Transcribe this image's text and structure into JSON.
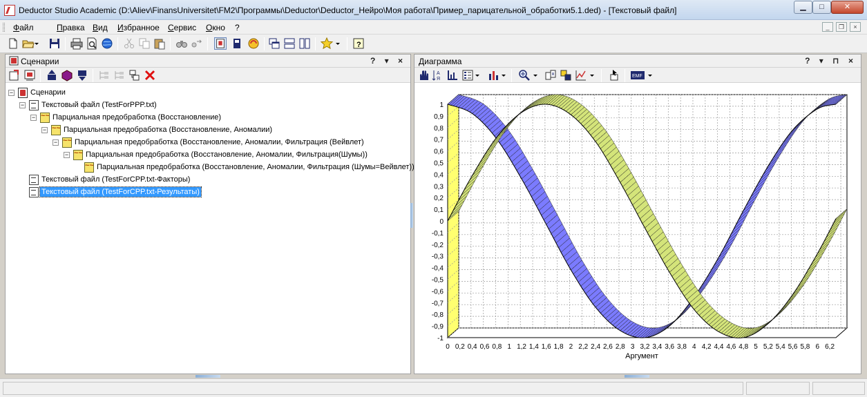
{
  "window": {
    "title": "Deductor Studio Academic (D:\\Aliev\\FinansUniversitet\\FM2\\Программы\\Deductor\\Deductor_Нейро\\Моя работа\\Пример_парицательной_обработки5.1.ded) - [Текстовый файл]"
  },
  "menu": [
    "Файл",
    "Правка",
    "Вид",
    "Избранное",
    "Сервис",
    "Окно",
    "?"
  ],
  "left_panel": {
    "title": "Сценарии",
    "controls": "? ▾ ×"
  },
  "tree": [
    {
      "label": "Сценарии",
      "level": 0,
      "icon": "scenario-icon",
      "expander": "−"
    },
    {
      "label": "Текстовый файл (TestForPPP.txt)",
      "level": 1,
      "icon": "text-file-icon",
      "expander": "−"
    },
    {
      "label": "Парциальная предобработка (Восстановление)",
      "level": 2,
      "icon": "preprocess-icon",
      "expander": "−"
    },
    {
      "label": "Парциальная предобработка (Восстановление, Аномалии)",
      "level": 3,
      "icon": "preprocess-icon",
      "expander": "−"
    },
    {
      "label": "Парциальная предобработка (Восстановление, Аномалии, Фильтрация (Вейвлет)",
      "level": 4,
      "icon": "preprocess-icon",
      "expander": "−"
    },
    {
      "label": "Парциальная предобработка (Восстановление, Аномалии, Фильтрация(Шумы))",
      "level": 5,
      "icon": "preprocess-icon",
      "expander": "−"
    },
    {
      "label": "Парциальная предобработка (Восстановление, Аномалии, Фильтрация (Шумы=Вейвлет))",
      "level": 6,
      "icon": "preprocess-icon",
      "expander": ""
    },
    {
      "label": "Текстовый файл (TestForCPP.txt-Факторы)",
      "level": 1,
      "icon": "text-file-icon",
      "expander": ""
    },
    {
      "label": "Текстовый файл (TestForCPP.txt-Результаты)",
      "level": 1,
      "icon": "text-file-icon",
      "expander": "",
      "selected": true
    }
  ],
  "right_panel": {
    "title": "Диаграмма",
    "controls": "? ▾ ⊓ ×"
  },
  "chart_data": {
    "type": "line",
    "style": "3d-ribbon",
    "xlabel": "Аргумент",
    "ylabel": "",
    "xlim": [
      0,
      6.3
    ],
    "ylim": [
      -1,
      1
    ],
    "x_ticks": [
      "0",
      "0,2",
      "0,4",
      "0,6",
      "0,8",
      "1",
      "1,2",
      "1,4",
      "1,6",
      "1,8",
      "2",
      "2,2",
      "2,4",
      "2,6",
      "2,8",
      "3",
      "3,2",
      "3,4",
      "3,6",
      "3,8",
      "4",
      "4,2",
      "4,4",
      "4,6",
      "4,8",
      "5",
      "5,2",
      "5,4",
      "5,6",
      "5,8",
      "6",
      "6,2"
    ],
    "y_ticks": [
      "-1",
      "-0,9",
      "-0,8",
      "-0,7",
      "-0,6",
      "-0,5",
      "-0,4",
      "-0,3",
      "-0,2",
      "-0,1",
      "0",
      "0,1",
      "0,2",
      "0,3",
      "0,4",
      "0,5",
      "0,6",
      "0,7",
      "0,8",
      "0,9",
      "1"
    ],
    "grid": true,
    "series": [
      {
        "color": "#7b7bff",
        "x": [
          0,
          0.4,
          0.8,
          1.2,
          1.6,
          2.0,
          2.4,
          2.8,
          3.2,
          3.6,
          4.0,
          4.4,
          4.8,
          5.2,
          5.6,
          6.0,
          6.3
        ],
        "values": [
          1.0,
          0.92,
          0.7,
          0.36,
          -0.03,
          -0.42,
          -0.74,
          -0.94,
          -1.0,
          -0.9,
          -0.65,
          -0.31,
          0.09,
          0.47,
          0.78,
          0.96,
          1.0
        ]
      },
      {
        "color": "#d4e47a",
        "x": [
          0,
          0.4,
          0.8,
          1.2,
          1.6,
          2.0,
          2.4,
          2.8,
          3.2,
          3.6,
          4.0,
          4.4,
          4.8,
          5.2,
          5.6,
          6.0,
          6.3
        ],
        "values": [
          0.0,
          0.39,
          0.72,
          0.93,
          1.0,
          0.91,
          0.68,
          0.33,
          -0.06,
          -0.44,
          -0.76,
          -0.95,
          -1.0,
          -0.88,
          -0.63,
          -0.28,
          0.02
        ]
      }
    ],
    "wall_color": "#ffff70"
  },
  "icons": {
    "toolbar": [
      "new-icon",
      "open-icon",
      "save-icon",
      "print-icon",
      "preview-icon",
      "web-icon",
      "cut-icon",
      "copy-icon",
      "paste-icon",
      "find-icon",
      "replace-icon",
      "scenario-view-icon",
      "data-icon",
      "wizard-icon",
      "cascade-icon",
      "tile-h-icon",
      "tile-v-icon",
      "favorites-icon",
      "help-icon"
    ]
  }
}
